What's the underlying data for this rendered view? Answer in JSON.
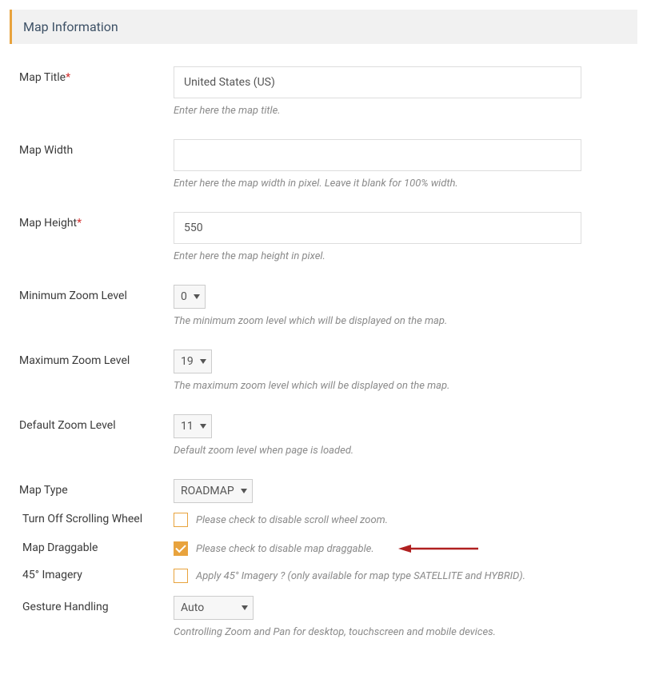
{
  "header": "Map Information",
  "fields": {
    "map_title": {
      "label": "Map Title",
      "required": true,
      "value": "United States (US)",
      "hint": "Enter here the map title."
    },
    "map_width": {
      "label": "Map Width",
      "value": "",
      "hint": "Enter here the map width in pixel. Leave it blank for 100% width."
    },
    "map_height": {
      "label": "Map Height",
      "required": true,
      "value": "550",
      "hint": "Enter here the map height in pixel."
    },
    "min_zoom": {
      "label": "Minimum Zoom Level",
      "value": "0",
      "hint": "The minimum zoom level which will be displayed on the map."
    },
    "max_zoom": {
      "label": "Maximum Zoom Level",
      "value": "19",
      "hint": "The maximum zoom level which will be displayed on the map."
    },
    "default_zoom": {
      "label": "Default Zoom Level",
      "value": "11",
      "hint": "Default zoom level when page is loaded."
    },
    "map_type": {
      "label": "Map Type",
      "value": "ROADMAP"
    },
    "scroll_wheel": {
      "label": "Turn Off Scrolling Wheel",
      "checked": false,
      "desc": "Please check to disable scroll wheel zoom."
    },
    "draggable": {
      "label": "Map Draggable",
      "checked": true,
      "desc": "Please check to disable map draggable."
    },
    "imagery": {
      "label": "45° Imagery",
      "checked": false,
      "desc": "Apply 45° Imagery ? (only available for map type SATELLITE and HYBRID)."
    },
    "gesture": {
      "label": "Gesture Handling",
      "value": "Auto",
      "hint": "Controlling Zoom and Pan for desktop, touchscreen and mobile devices."
    }
  }
}
